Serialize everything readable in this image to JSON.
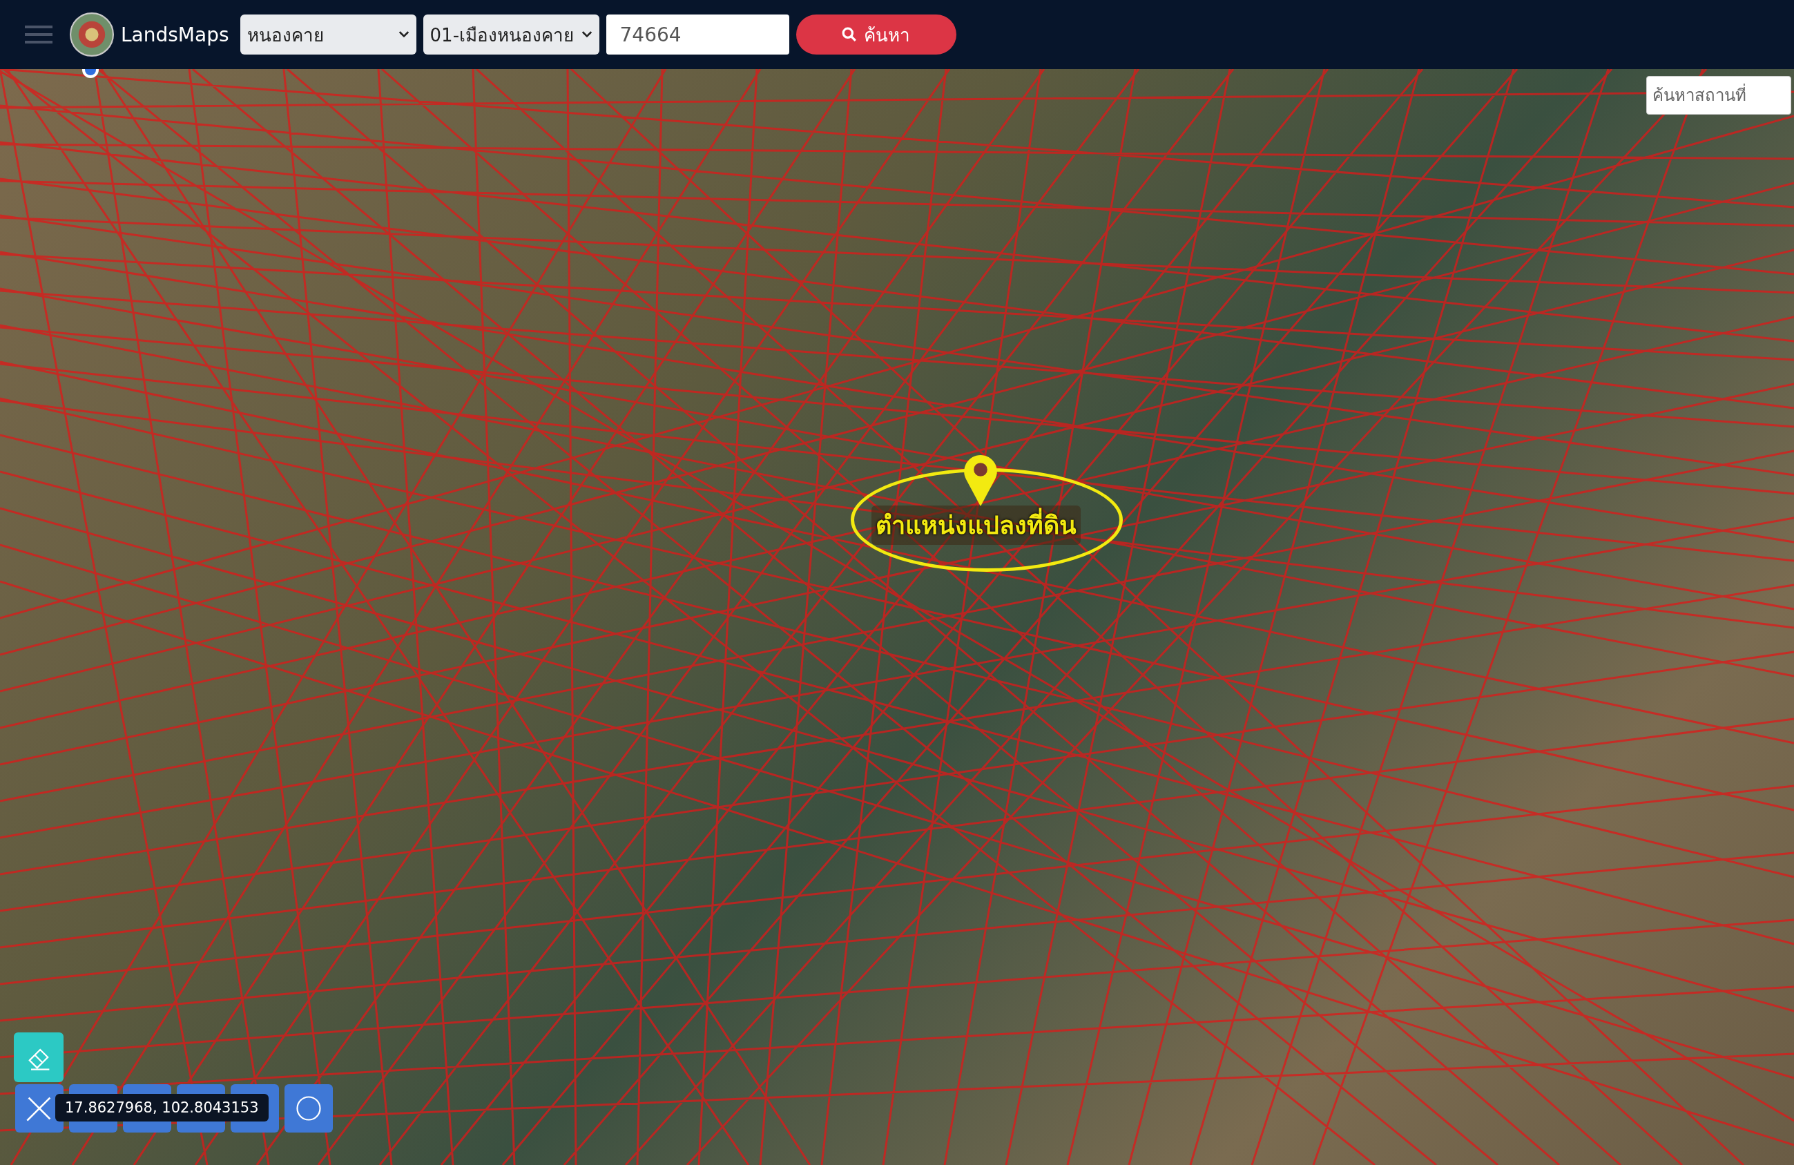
{
  "header": {
    "app_name": "LandsMaps",
    "province_select": {
      "value": "หนองคาย"
    },
    "district_select": {
      "value": "01-เมืองหนองคาย"
    },
    "parcel_field": {
      "value": "74664"
    },
    "search_button": "ค้นหา"
  },
  "place_search": {
    "placeholder": "ค้นหาสถานที่"
  },
  "map": {
    "marker_label": "ตำแหน่งแปลงที่ดิน",
    "coordinates": "17.8627968, 102.8043153"
  }
}
